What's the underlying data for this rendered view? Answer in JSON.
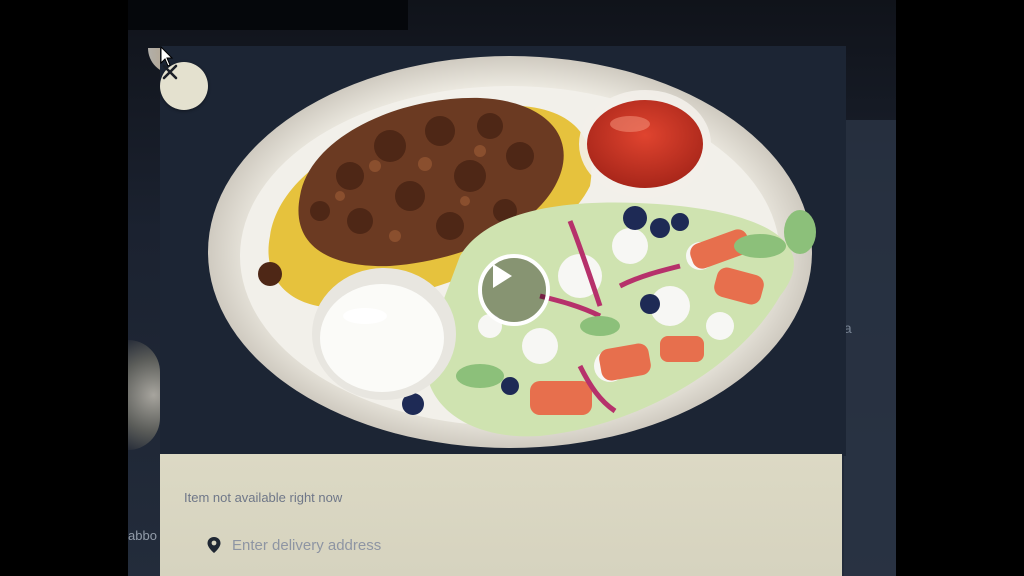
{
  "modal": {
    "close_icon": "close-icon",
    "play_icon": "play-icon",
    "availability_text": "Item not available right now",
    "address": {
      "icon": "location-pin-icon",
      "placeholder": "Enter delivery address",
      "value": ""
    }
  },
  "background": {
    "right_fragment": "ta",
    "left_fragment": "abbo"
  },
  "colors": {
    "modal_footer": "#d8d5c1",
    "close_button_bg": "#e4e1cf",
    "muted_text": "#6f7788"
  }
}
